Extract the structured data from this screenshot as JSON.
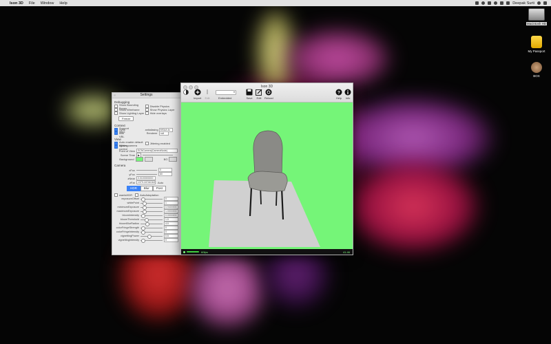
{
  "menubar": {
    "app_name": "Ison 3D",
    "items": [
      "File",
      "Window",
      "Help"
    ],
    "user": "Deepak Surti"
  },
  "desktop": {
    "icons": [
      {
        "label": "Macintosh HD",
        "icon": "hard-drive-icon"
      },
      {
        "label": "My Passport",
        "icon": "external-drive-icon"
      },
      {
        "label": "BOX",
        "icon": "box-folder-icon"
      }
    ]
  },
  "settings": {
    "title": "Settings",
    "debugging": {
      "title": "Debugging",
      "checks": [
        {
          "label": "Show Bounding Boxes",
          "on": false
        },
        {
          "label": "Disable Physics",
          "on": false
        },
        {
          "label": "Show Wireframe",
          "on": false
        },
        {
          "label": "Show Physics Layer",
          "on": false
        },
        {
          "label": "Show Lighting Layer",
          "on": false
        },
        {
          "label": "Hide overlays",
          "on": false
        }
      ],
      "button": "Freeze"
    },
    "context": {
      "title": "Context",
      "checks": [
        {
          "label": "Support ibmx",
          "on": true
        },
        {
          "label": "Sync with VBL",
          "on": true
        }
      ],
      "antialiasing_label": "antialiasing",
      "antialiasing_value": "MSAA 4x",
      "renderer_label": "Renderer",
      "renderer_value": "null"
    },
    "view": {
      "title": "View",
      "checks": [
        {
          "label": "Auto enable default lighting",
          "on": true
        },
        {
          "label": "Jittering enabled",
          "on": false
        },
        {
          "label": "Allows camera control",
          "on": true
        }
      ],
      "scene_row_label": "Point of View",
      "scene_row_value": "SCNCamera(CameraNode)",
      "scene_time_label": "Scene Time",
      "background_label": "Background",
      "bg_label": "BG"
    },
    "camera": {
      "title": "Camera",
      "xfov_label": "xFov",
      "xfov_value": "0",
      "yfov_label": "yFov",
      "yfov_value": "60",
      "znear_label": "zNear",
      "znear_value": "0.0100000000",
      "zfar_label": "zFar",
      "zfar_value": "1379.167440445",
      "zfar_unit": "Auto",
      "tabs": [
        "HDR",
        "Blur",
        "Post"
      ],
      "active_tab": "HDR",
      "wants_hdr_label": "wantsHDR",
      "auto_adjust_label": "AutoAdaptation",
      "sliders": [
        {
          "label": "exposureOffset",
          "value": "0",
          "fill": 0.05
        },
        {
          "label": "whitePoint",
          "value": "1",
          "fill": 0.1
        },
        {
          "label": "minimumExposure",
          "value": "0.9400000",
          "fill": 0.1
        },
        {
          "label": "maximumExposure",
          "value": "1.0000000",
          "fill": 0.1
        },
        {
          "label": "bloomIntensity",
          "value": "0.0000000",
          "fill": 0.05
        },
        {
          "label": "bloomThreshold",
          "value": "1.0",
          "fill": 0.2
        },
        {
          "label": "bloomBlurRadius",
          "value": "4.0",
          "fill": 0.25
        },
        {
          "label": "colorFringeStrength",
          "value": "0",
          "fill": 0.05
        },
        {
          "label": "colorFringeIntensity",
          "value": "0",
          "fill": 0.05
        },
        {
          "label": "vignettingPower",
          "value": "0.5",
          "fill": 0.35
        },
        {
          "label": "vignettingIntensity",
          "value": "0",
          "fill": 0.05
        }
      ]
    }
  },
  "main_window": {
    "title": "Ison 3D",
    "toolbar": [
      {
        "label": "Import",
        "icon": "import-icon"
      },
      {
        "label": "Edit",
        "icon": "edit-icon"
      },
      {
        "label": "Embedded",
        "icon": "popup-icon"
      },
      {
        "label": "Save",
        "icon": "save-icon"
      },
      {
        "label": "Edit",
        "icon": "note-edit-icon"
      },
      {
        "label": "Reload",
        "icon": "reload-icon"
      },
      {
        "label": "Help",
        "icon": "help-icon"
      },
      {
        "label": "Info",
        "icon": "info-icon"
      }
    ],
    "status": {
      "fps": "60fps",
      "right": "41.46"
    }
  },
  "colors": {
    "viewport_bg": "#75f578",
    "accent": "#3b82f6"
  }
}
